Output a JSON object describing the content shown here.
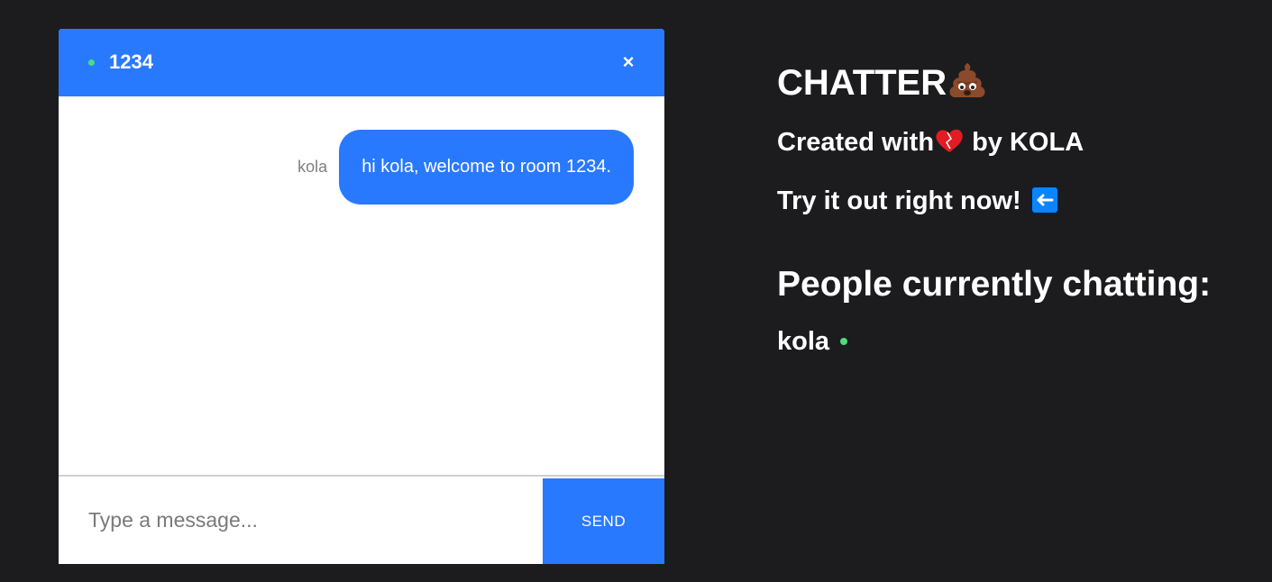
{
  "chat": {
    "room_name": "1234",
    "close_symbol": "×",
    "messages": [
      {
        "author": "kola",
        "text": "hi kola, welcome to room 1234."
      }
    ],
    "composer": {
      "placeholder": "Type a message...",
      "value": "",
      "send_label": "SEND"
    }
  },
  "info": {
    "title": "CHATTER",
    "credit_prefix": "Created with",
    "credit_suffix": " by KOLA",
    "cta": "Try it out right now!",
    "people_heading": "People currently chatting:",
    "people": [
      {
        "name": "kola",
        "online": true
      }
    ]
  },
  "icons": {
    "title_emoji": "poo-emoji-icon",
    "credit_emoji": "heart-icon",
    "cta_emoji": "left-arrow-icon"
  },
  "colors": {
    "background": "#1c1c1e",
    "accent": "#2979ff",
    "online": "#4ade80",
    "panel": "#ffffff"
  }
}
